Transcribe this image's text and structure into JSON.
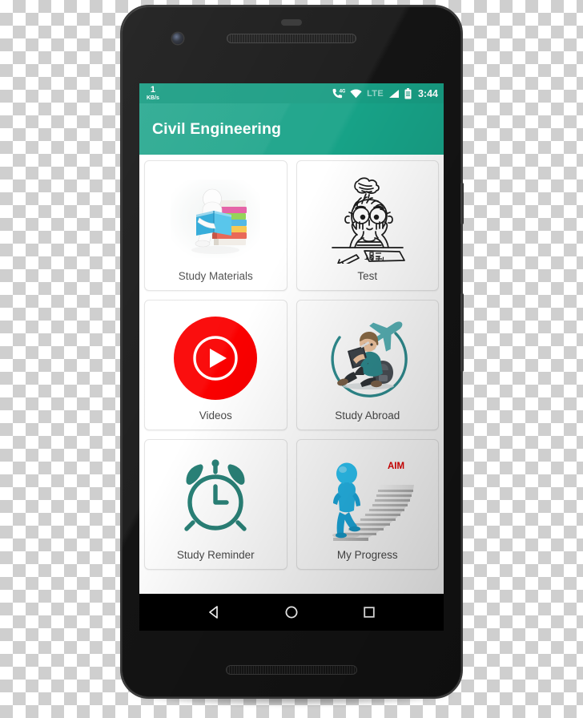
{
  "device": {
    "name": "android-smartphone",
    "body_color": "#141414",
    "hardware": {
      "front_camera": "front-camera",
      "earpiece_speaker": "earpiece-speaker",
      "bottom_speaker": "bottom-speaker",
      "power_button": "power-button",
      "volume_button": "volume-button"
    }
  },
  "statusbar": {
    "background": "#179c82",
    "network_speed_value": "1",
    "network_speed_unit": "KB/s",
    "icons": [
      {
        "name": "call-4g-icon",
        "label": "4G"
      },
      {
        "name": "wifi-icon",
        "label": ""
      },
      {
        "name": "lte-label",
        "label": "LTE"
      },
      {
        "name": "signal-bars-icon",
        "label": ""
      },
      {
        "name": "battery-icon",
        "label": ""
      }
    ],
    "clock": "3:44"
  },
  "appbar": {
    "background": "#17a287",
    "title": "Civil Engineering"
  },
  "grid": {
    "items": [
      {
        "label": "Study Materials",
        "icon": "study-materials-illustration"
      },
      {
        "label": "Test",
        "icon": "test-illustration"
      },
      {
        "label": "Videos",
        "icon": "videos-play-icon"
      },
      {
        "label": "Study Abroad",
        "icon": "study-abroad-illustration"
      },
      {
        "label": "Study Reminder",
        "icon": "alarm-clock-icon"
      },
      {
        "label": "My Progress",
        "icon": "my-progress-illustration"
      }
    ],
    "label_color": "#4a4a4a",
    "accent_teal": "#2a8278",
    "videos_red": "#fa0000",
    "aim_text": "AIM",
    "test_paper_text": "TEST"
  },
  "navbar": {
    "background": "#000000",
    "buttons": [
      {
        "name": "back-button",
        "label": "Back"
      },
      {
        "name": "home-button",
        "label": "Home"
      },
      {
        "name": "recents-button",
        "label": "Recent apps"
      }
    ]
  }
}
